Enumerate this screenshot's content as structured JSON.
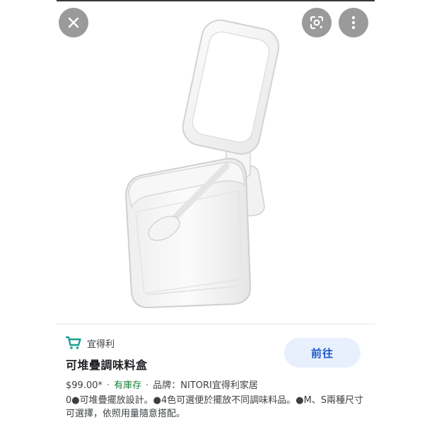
{
  "viewer": {
    "close_icon": "close-icon",
    "lens_icon": "google-lens-icon",
    "more_icon": "more-vertical-icon"
  },
  "product_image": {
    "subject": "seasoning-box-image"
  },
  "result": {
    "site_icon": "shopping-cart-icon",
    "site_name": "宜得利",
    "title": "可堆疊調味料盒",
    "go_button": "前往",
    "price": "$99.00*",
    "stock": "有庫存",
    "brand": "品牌：NITORI宜得利家居",
    "description": "0●可堆疊擺放設計。●4色可選便於擺放不同調味料品。●M、S兩種尺寸可選擇，依照用量隨意搭配。"
  },
  "colors": {
    "accent": "#1a56c8",
    "button_bg": "#e8f0fe",
    "stock_green": "#188038",
    "cart_teal": "#1a9e8f"
  }
}
